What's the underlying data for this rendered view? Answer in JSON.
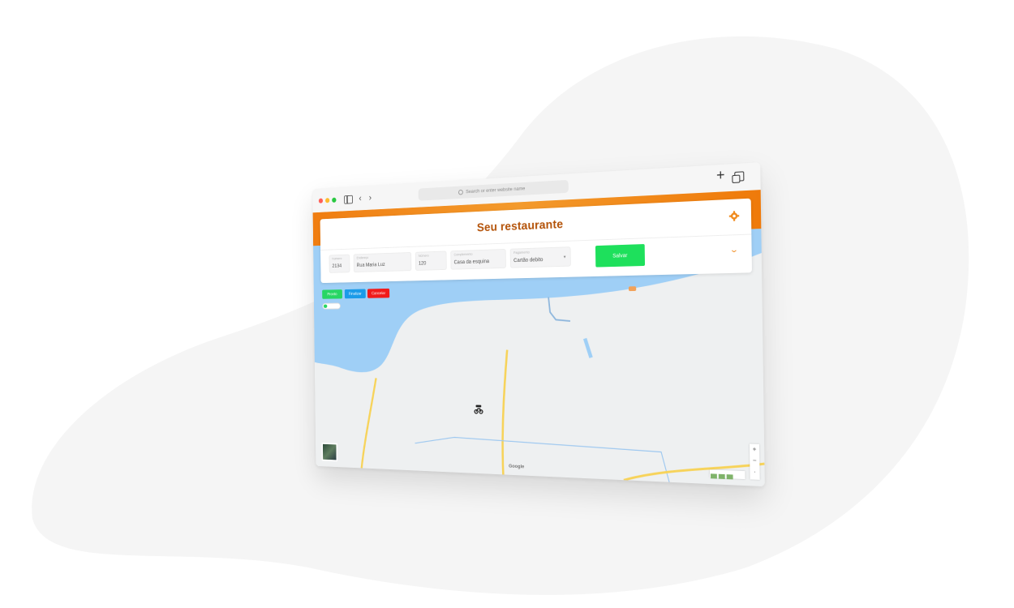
{
  "browser": {
    "address_placeholder": "Search or enter website name",
    "plus_icon": "+"
  },
  "header": {
    "title": "Seu restaurante"
  },
  "form": {
    "fields": [
      {
        "label": "Numero",
        "value": "2134"
      },
      {
        "label": "Endereço",
        "value": "Rua Maria Luz"
      },
      {
        "label": "Número",
        "value": "120"
      },
      {
        "label": "Complemento",
        "value": "Casa da esquina"
      },
      {
        "label": "Pagamento",
        "value": "Cartão debito"
      }
    ],
    "save_label": "Salvar"
  },
  "actions": {
    "pronto": "Pronto",
    "finalizar": "Finalizar",
    "cancelar": "Cancelar"
  },
  "map": {
    "google_label": "Google"
  },
  "colors": {
    "accent_orange": "#f07d10",
    "title_brown": "#b45309",
    "green": "#1ee05c",
    "blue": "#1b9be9",
    "red": "#f11b1b",
    "water": "#9fcff6"
  }
}
